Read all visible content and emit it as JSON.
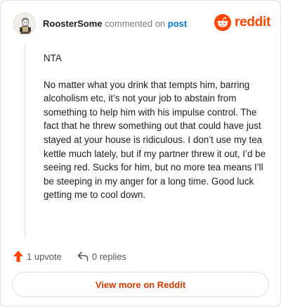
{
  "comment": {
    "username": "RoosterSome",
    "action_text": "commented on",
    "post_link": "post",
    "paragraphs": [
      "NTA",
      "No matter what you drink that tempts him, barring alcoholism etc, it’s not your job to abstain from something to help him with his impulse control. The fact that he threw something out that could have just stayed at your house is ridiculous. I don’t use my tea kettle much lately, but if my partner threw it out, I’d be seeing red. Sucks for him, but no more tea means I’ll be steeping in my anger for a long time. Good luck getting me to cool down."
    ]
  },
  "brand": {
    "name": "reddit",
    "icon": "reddit-snoo-icon",
    "color": "#ff4500"
  },
  "actions": {
    "upvote_label": "1 upvote",
    "upvote_icon": "upvote-arrow-icon",
    "reply_label": "0 replies",
    "reply_icon": "reply-arrow-icon"
  },
  "footer": {
    "view_more_label": "View more on Reddit"
  },
  "colors": {
    "accent": "#ff4500",
    "link": "#0079d3",
    "button_text": "#d93a00"
  }
}
